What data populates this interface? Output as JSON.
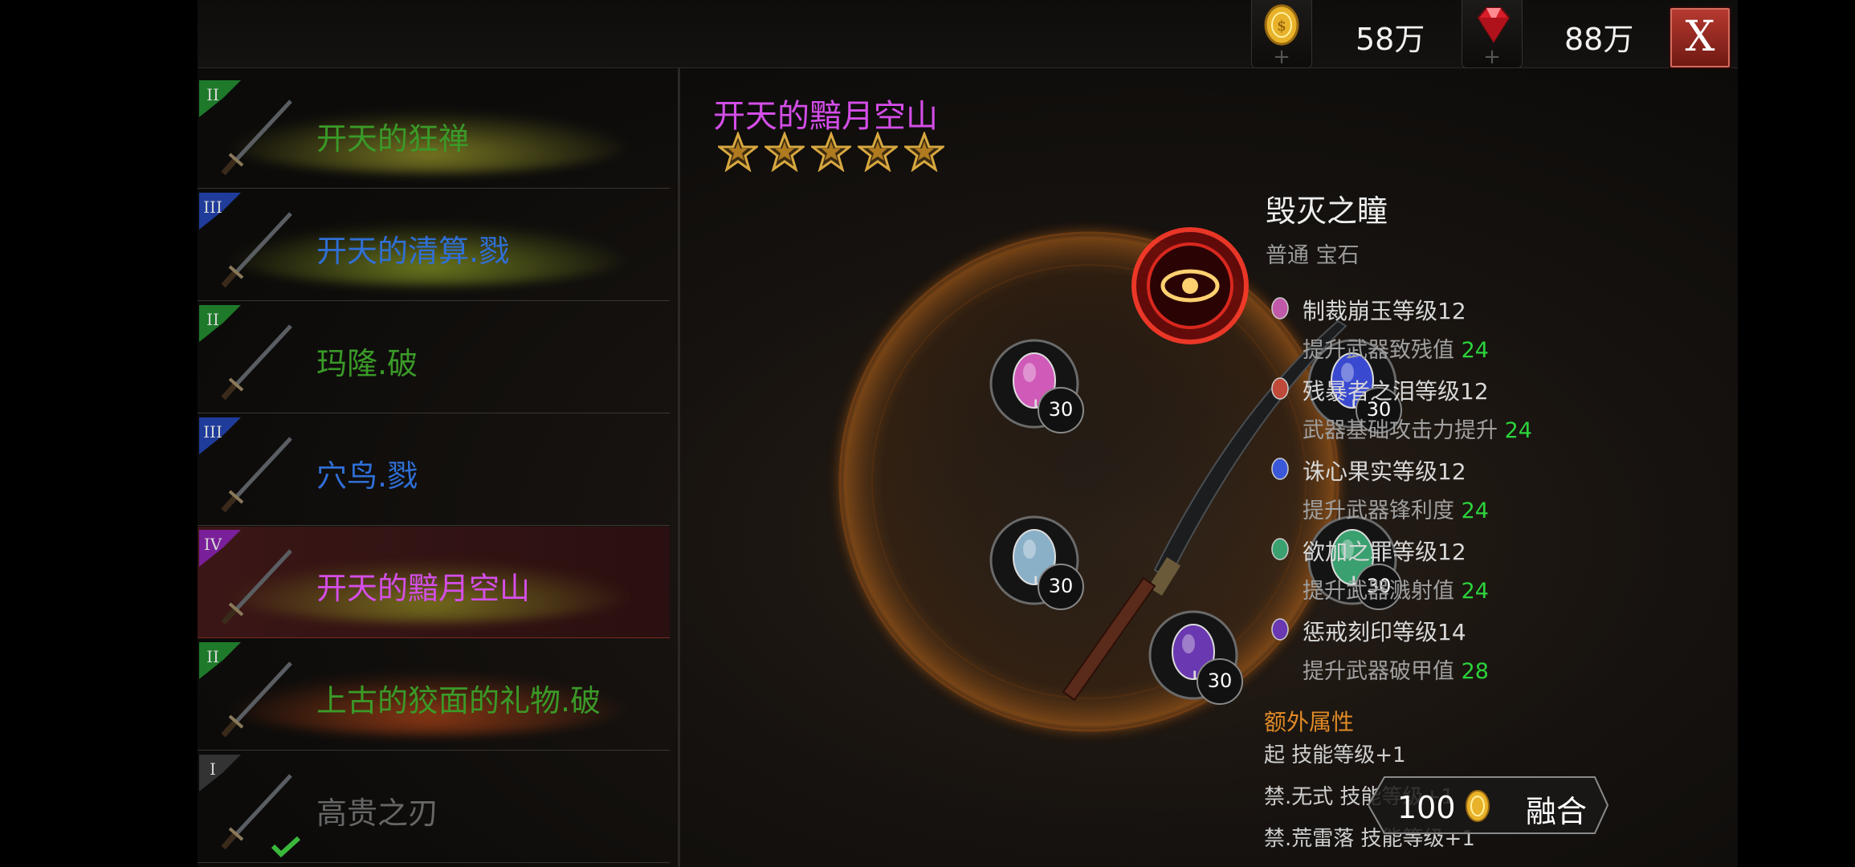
{
  "topbar": {
    "gold": {
      "icon": "gold-coin-icon",
      "value": "58万",
      "plus": "+"
    },
    "gems": {
      "icon": "ruby-icon",
      "value": "88万",
      "plus": "+"
    },
    "close_label": "X"
  },
  "weapon_list": [
    {
      "tier": "II",
      "name": "开天的狂禅",
      "name_color": "#3a9a28",
      "tier_color": "#1e7a2a",
      "smoke": "#9a9a2a",
      "selected": false
    },
    {
      "tier": "III",
      "name": "开天的清算.戮",
      "name_color": "#2f6fd6",
      "tier_color": "#1f3c9a",
      "smoke": "#8a9a24",
      "selected": false
    },
    {
      "tier": "II",
      "name": "玛隆.破",
      "name_color": "#3a9a28",
      "tier_color": "#1e7a2a",
      "smoke": "",
      "selected": false
    },
    {
      "tier": "III",
      "name": "穴鸟.戮",
      "name_color": "#2f6fd6",
      "tier_color": "#1f3c9a",
      "smoke": "",
      "selected": false
    },
    {
      "tier": "IV",
      "name": "开天的黯月空山",
      "name_color": "#d44ee8",
      "tier_color": "#7a1f9a",
      "smoke": "#8a8a20",
      "selected": true
    },
    {
      "tier": "II",
      "name": "上古的狡面的礼物.破",
      "name_color": "#3a9a28",
      "tier_color": "#1e7a2a",
      "smoke": "#b04416",
      "selected": false
    },
    {
      "tier": "I",
      "name": "高贵之刃",
      "name_color": "#666666",
      "tier_color": "#333333",
      "smoke": "",
      "selected": false,
      "equipped": true
    }
  ],
  "item": {
    "title": "开天的黯月空山",
    "stars": 5,
    "sockets": [
      {
        "level": "30",
        "lu": "Lu",
        "color": "#d05ab8"
      },
      {
        "level": "30",
        "lu": "Lu",
        "color": "#3a4ad0"
      },
      {
        "level": "30",
        "lu": "Lu",
        "color": "#8ab0c8"
      },
      {
        "level": "30",
        "lu": "Lu",
        "color": "#3aa070"
      },
      {
        "level": "30",
        "lu": "Lu",
        "color": "#6a38b0"
      }
    ]
  },
  "gem": {
    "name": "毁灭之瞳",
    "type": "普通 宝石",
    "stats": [
      {
        "icon": "pink-gem-icon",
        "color": "#c05aa8",
        "name": "制裁崩玉等级12",
        "desc": "提升武器致残值",
        "value": "24"
      },
      {
        "icon": "crystal-gem-icon",
        "color": "#c04a3a",
        "name": "残暴者之泪等级12",
        "desc": "武器基础攻击力提升",
        "value": "24"
      },
      {
        "icon": "blue-gem-icon",
        "color": "#3a58d8",
        "name": "诛心果实等级12",
        "desc": "提升武器锋利度",
        "value": "24"
      },
      {
        "icon": "green-gem-icon",
        "color": "#3aa070",
        "name": "欲加之罪等级12",
        "desc": "提升武器溅射值",
        "value": "24"
      },
      {
        "icon": "purple-gem-icon",
        "color": "#6a38b0",
        "name": "惩戒刻印等级14",
        "desc": "提升武器破甲值",
        "value": "28"
      }
    ],
    "extra_title": "额外属性",
    "extras": [
      "起 技能等级+1",
      "禁.无式 技能等级+1",
      "禁.荒雷落 技能等级+1"
    ]
  },
  "fuse": {
    "cost": "100",
    "label": "融合",
    "icon": "gold-coin-icon"
  }
}
